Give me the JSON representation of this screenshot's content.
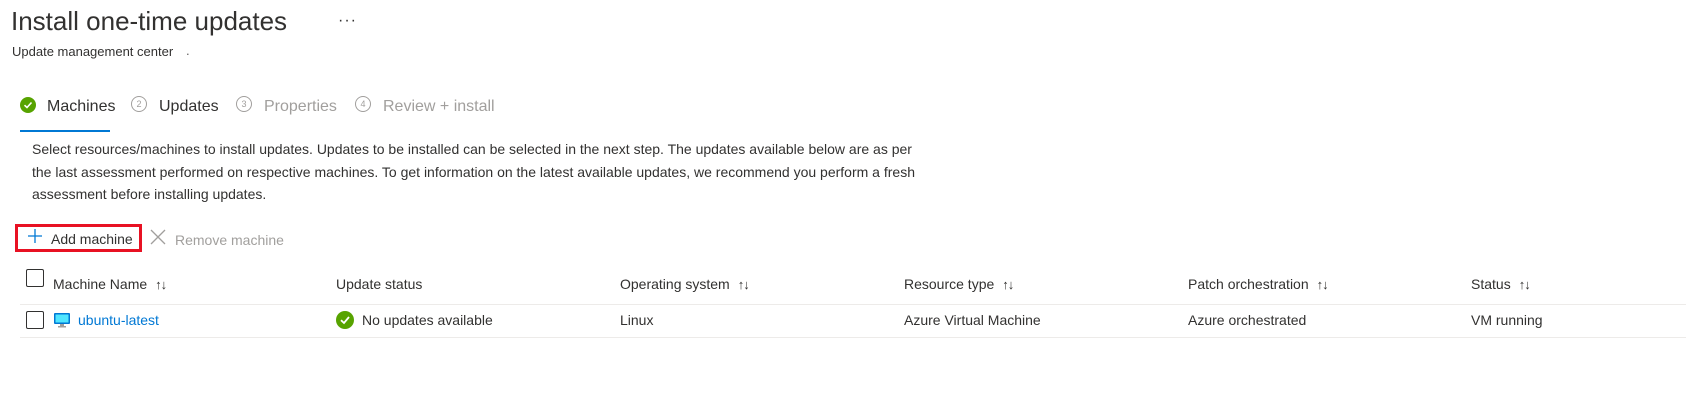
{
  "header": {
    "title": "Install one-time updates",
    "more_label": "···",
    "subtitle": "Update management center",
    "subtitle_suffix": "."
  },
  "wizard": {
    "steps": [
      {
        "number": "1",
        "label": "Machines",
        "state": "completed"
      },
      {
        "number": "2",
        "label": "Updates",
        "state": "normal"
      },
      {
        "number": "3",
        "label": "Properties",
        "state": "disabled"
      },
      {
        "number": "4",
        "label": "Review + install",
        "state": "disabled"
      }
    ]
  },
  "description": "Select resources/machines to install updates. Updates to be installed can be selected in the next step. The updates available below are as per the last assessment performed on respective machines. To get information on the latest available updates, we recommend you perform a fresh assessment before installing updates.",
  "toolbar": {
    "add_label": "Add machine",
    "remove_label": "Remove machine"
  },
  "table": {
    "columns": [
      {
        "label": "Machine Name",
        "sortable": true
      },
      {
        "label": "Update status",
        "sortable": false
      },
      {
        "label": "Operating system",
        "sortable": true
      },
      {
        "label": "Resource type",
        "sortable": true
      },
      {
        "label": "Patch orchestration",
        "sortable": true
      },
      {
        "label": "Status",
        "sortable": true
      }
    ],
    "sort_glyph": "↑↓",
    "rows": [
      {
        "machine_name": "ubuntu-latest",
        "update_status": "No updates available",
        "operating_system": "Linux",
        "resource_type": "Azure Virtual Machine",
        "patch_orchestration": "Azure orchestrated",
        "status": "VM running"
      }
    ]
  },
  "colors": {
    "accent": "#0078d4",
    "success": "#57a300",
    "highlight": "#e81123"
  }
}
